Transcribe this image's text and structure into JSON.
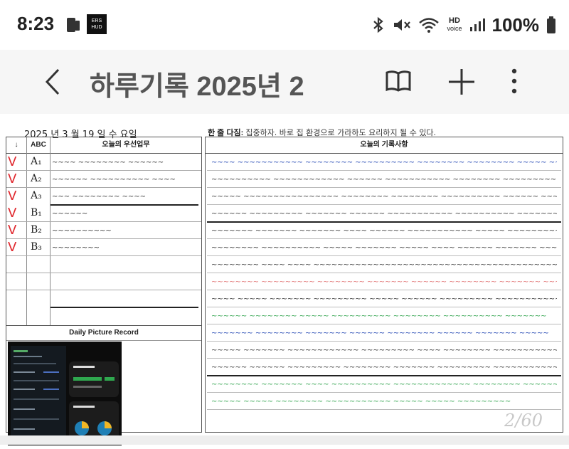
{
  "status_bar": {
    "time": "8:23",
    "app_icon_text": "ERS\nHUD",
    "battery_text": "100%",
    "icons": [
      "phone-icon",
      "bluetooth-icon",
      "mute-icon",
      "wifi-icon",
      "hd-voice-icon",
      "signal-icon",
      "battery-icon"
    ],
    "hd_label": "HD",
    "voice_label": "voice"
  },
  "app_bar": {
    "title": "하루기록 2025년 2",
    "icons": [
      "back-icon",
      "book-icon",
      "plus-icon",
      "more-icon"
    ]
  },
  "sheet": {
    "date_line": "2025 년  3  월  19 일  수  요일",
    "resolve_label": "한 줄 다짐:",
    "resolve_text": "집중하자.  바로 집 환경으로  가라하도 요리하지 될 수 있다.",
    "left_headers": {
      "arrow": "↓",
      "abc": "ABC",
      "priority": "오늘의 우선업무"
    },
    "tasks": [
      {
        "check": "V",
        "code": "A₁",
        "text": "~~~~ ~~~~~~~~ ~~~~~~"
      },
      {
        "check": "V",
        "code": "A₂",
        "text": "~~~~~~ ~~~~~~~~~~ ~~~~"
      },
      {
        "check": "V",
        "code": "A₃",
        "text": "~~~ ~~~~~~~~ ~~~~"
      },
      {
        "check": "V",
        "code": "B₁",
        "text": "~~~~~~"
      },
      {
        "check": "V",
        "code": "B₂",
        "text": "~~~~~~~~~~"
      },
      {
        "check": "V",
        "code": "B₃",
        "text": "~~~~~~~~"
      }
    ],
    "picture_record_label": "Daily Picture Record",
    "right_header": "오늘의 기록사항",
    "log_lines": [
      {
        "color": "#1a3fb0",
        "text": "~~~~ ~~~~~~~~~~~ ~~~~~~~~ ~~~~~~~~~~ ~~~~~~~~ ~~~~~~~~ ~~~~~ ~~~"
      },
      {
        "color": "#333333",
        "text": "~~~~~~~~~~ ~~~~~~~~~~~~ ~~~~~~ ~~~~~~~~~~~ ~~~~~~~~ ~~~~~~~~~~~~"
      },
      {
        "color": "#333333",
        "text": "~~~~~ ~~~~~~~~~~~~~~~~ ~~~~~~~~ ~~~~~~~~ ~~~~~~~~~~ ~~~~~~ ~~~~"
      },
      {
        "color": "#333333",
        "text": "~~~~~~ ~~~~~~~~~ ~~~~~~~ ~~~~~~ ~~~~~~~~~~~ ~~~~~~~~~~ ~~~~~~~~~"
      },
      {
        "color": "#333333",
        "text": "~~~~~~~ ~~~~~~~ ~~~~~~~ ~~~~ ~~~~~~ ~~~~~~~~~~~ ~~~~~ ~~~~~~~~~~"
      },
      {
        "color": "#333333",
        "text": "~~~~~~~~ ~~~~~~~~~~ ~~~~~ ~~~~~~~ ~~~~~ ~~~~ ~~~~~~ ~~~~~~~ ~~~~"
      },
      {
        "color": "#333333",
        "text": "~~~~~~~~ ~~~~ ~~~~  ~~~~~~~~~~~~~~~~~~~~~~~~~~~~~~~~~~~~~~~~~~"
      },
      {
        "color": "#e07070",
        "text": "~~~~~~~~ ~~~~~~~~~ ~~~~~~~~ ~~~~~~~ ~~~~~~ ~~~~~~~~ ~~~~~~~ ~~~~"
      },
      {
        "color": "#333333",
        "text": "~~~~ ~~~~~ ~~~~~~~ ~~~~~~~~~ ~~~~~ ~~~~~~ ~~~~~~~~~ ~~~~~~~~~~~"
      },
      {
        "color": "#2aa048",
        "text": "~~~~~~ ~~~~~~~~ ~~~~~ ~~~~~~~~~~ ~~~~~~~~ ~~~~~~~~~~ ~~~~~~~"
      },
      {
        "color": "#1a3fb0",
        "text": "~~~~~~~ ~~~~~~~~ ~~~~~~~ ~~~~~~ ~~~~~~~~ ~~~~~~ ~~~~~~~ ~~~~~"
      },
      {
        "color": "#333333",
        "text": "~~~~~ ~~~~~~~ ~~~~~~~~~~~~ ~~~~~~~~~ ~~~~ ~~~~~~~~ ~~~~~~~~~~~~"
      },
      {
        "color": "#333333",
        "text": "~~~~~~ ~~~~~~ ~~~~~~~~~ ~~~~~~~~ ~~~~~~~ ~~~~~~~~~ ~~~~~~~~~~~~"
      },
      {
        "color": "#2aa048",
        "text": "~~~~~~~~ ~~~~~~~ ~~~~  ~~~~~~~~~~ ~~~~~~~~~~~~~ ~~~~~~~~ ~~~~~~"
      },
      {
        "color": "#2aa048",
        "text": "~~~~~ ~~~~~ ~~~~~~~~ ~~~~~~~~~~~ ~~~~~ ~~~~~ ~~~~~~~~~"
      }
    ],
    "page_number": "2/60"
  },
  "colors": {
    "check_red": "#e0282e",
    "ink_blue": "#1a3fb0",
    "ink_green": "#2aa048",
    "ink_pink": "#e07070"
  }
}
